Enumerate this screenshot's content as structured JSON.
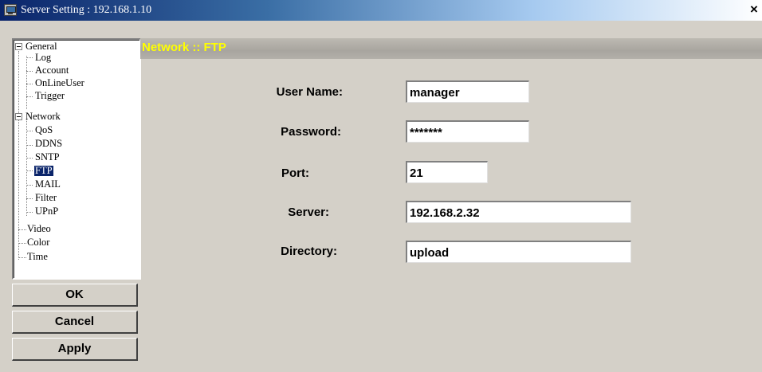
{
  "window": {
    "title": "Server Setting : 192.168.1.10",
    "close": "×"
  },
  "tree": {
    "general": "General",
    "log": "Log",
    "account": "Account",
    "online_user": "OnLineUser",
    "trigger": "Trigger",
    "network": "Network",
    "qos": "QoS",
    "ddns": "DDNS",
    "sntp": "SNTP",
    "ftp": "FTP",
    "mail": "MAIL",
    "filter": "Filter",
    "upnp": "UPnP",
    "video": "Video",
    "color": "Color",
    "time": "Time",
    "selected": "FTP"
  },
  "buttons": {
    "ok": "OK",
    "cancel": "Cancel",
    "apply": "Apply"
  },
  "panel": {
    "title": "Network :: FTP"
  },
  "form": {
    "user_name_label": "User Name:",
    "user_name_value": "manager",
    "password_label": "Password:",
    "password_value": "*******",
    "port_label": "Port:",
    "port_value": "21",
    "server_label": "Server:",
    "server_value": "192.168.2.32",
    "directory_label": "Directory:",
    "directory_value": "upload"
  }
}
